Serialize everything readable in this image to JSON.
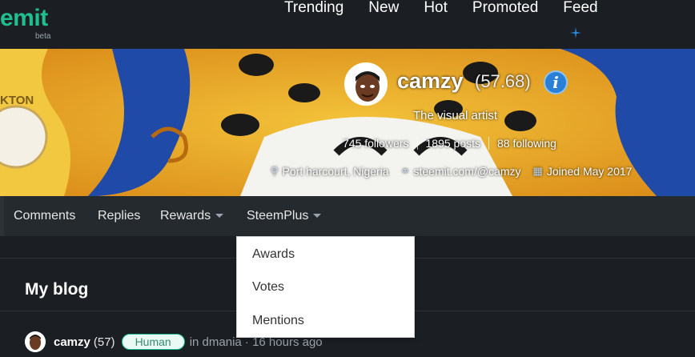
{
  "header": {
    "logo_text": "emit",
    "beta": "beta",
    "nav": [
      "Trending",
      "New",
      "Hot",
      "Promoted",
      "Feed"
    ],
    "accent": "#1fbf8f"
  },
  "profile": {
    "username": "camzy",
    "reputation": "(57.68)",
    "about": "The visual artist",
    "followers": "745 followers",
    "posts": "1895 posts",
    "following": "88 following",
    "location": "Port harcourt, Nigeria",
    "website": "steemit.com/@camzy",
    "joined": "Joined May 2017",
    "banner_badge": "KTON"
  },
  "subnav": {
    "tabs": [
      "Comments",
      "Replies",
      "Rewards",
      "SteemPlus"
    ]
  },
  "dropdown": {
    "items": [
      "Awards",
      "Votes",
      "Mentions"
    ]
  },
  "blog": {
    "title": "My blog",
    "post": {
      "author": "camzy",
      "rep": "(57)",
      "badge": "Human",
      "meta": "in dmania · 16 hours ago"
    }
  }
}
